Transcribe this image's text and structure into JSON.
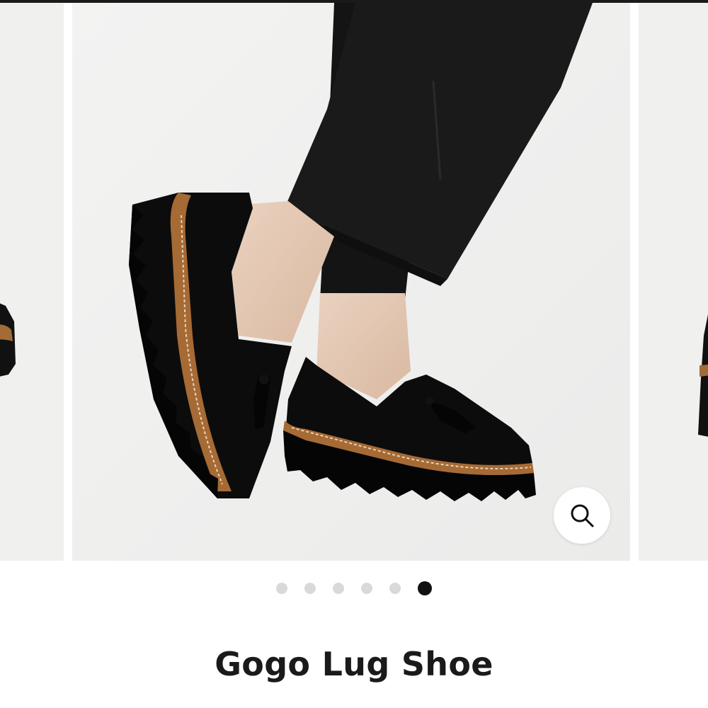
{
  "product": {
    "title": "Gogo Lug Shoe"
  },
  "gallery": {
    "slides": [
      {
        "subject": "shoe-side-view"
      },
      {
        "subject": "black-velvet-lug-sole-loafers-worn"
      },
      {
        "subject": "shoe-side-view"
      }
    ],
    "zoom_button_icon": "search-icon",
    "pagination": {
      "total": 6,
      "active_index": 5
    }
  },
  "colors": {
    "top_bar": "#1a1a1a",
    "dot_inactive": "#d9d9d9",
    "dot_active": "#111111",
    "title_text": "#1a1a1a",
    "photo_background": "#f0f0ef"
  }
}
